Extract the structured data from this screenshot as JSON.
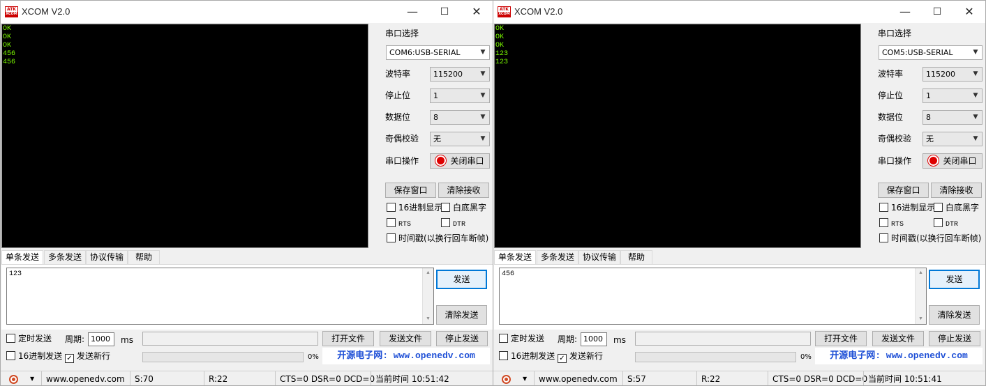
{
  "windows": [
    {
      "title": "XCOM V2.0",
      "logo_top": "ATK",
      "logo_bottom": "XCOM",
      "controls": {
        "minimize": "—",
        "maximize": "☐",
        "close": "✕"
      },
      "receive_lines": [
        "OK",
        "OK",
        "OK",
        "456",
        "456"
      ],
      "serial_port_label": "串口选择",
      "serial_port_value": "COM6:USB-SERIAL",
      "baud_label": "波特率",
      "baud_value": "115200",
      "stopbits_label": "停止位",
      "stopbits_value": "1",
      "databits_label": "数据位",
      "databits_value": "8",
      "parity_label": "奇偶校验",
      "parity_value": "无",
      "port_op_label": "串口操作",
      "close_port_label": "关闭串口",
      "save_window_label": "保存窗口",
      "clear_receive_label": "清除接收",
      "hex_display_label": "16进制显示",
      "white_bg_label": "白底黑字",
      "rts_label": "RTS",
      "dtr_label": "DTR",
      "timestamp_label": "时间戳(以换行回车断帧)",
      "tabs": [
        "单条发送",
        "多条发送",
        "协议传输",
        "帮助"
      ],
      "send_text": "123",
      "send_label": "发送",
      "clear_send_label": "清除发送",
      "timed_send_label": "定时发送",
      "period_label": "周期:",
      "period_value": "1000",
      "ms_label": "ms",
      "open_file_label": "打开文件",
      "send_file_label": "发送文件",
      "stop_send_label": "停止发送",
      "hex_send_label": "16进制发送",
      "newline_label": "发送新行",
      "newline_checked": "✓",
      "progress_percent": "0%",
      "link_text": "开源电子网: www.openedv.com",
      "status_url": "www.openedv.com",
      "status_sent": "S:70",
      "status_recv": "R:22",
      "status_lines": "CTS=0 DSR=0 DCD=0",
      "status_time": "当前时间 10:51:42"
    },
    {
      "title": "XCOM V2.0",
      "logo_top": "ATK",
      "logo_bottom": "XCOM",
      "controls": {
        "minimize": "—",
        "maximize": "☐",
        "close": "✕"
      },
      "receive_lines": [
        "OK",
        "OK",
        "OK",
        "123",
        "123"
      ],
      "serial_port_label": "串口选择",
      "serial_port_value": "COM5:USB-SERIAL",
      "baud_label": "波特率",
      "baud_value": "115200",
      "stopbits_label": "停止位",
      "stopbits_value": "1",
      "databits_label": "数据位",
      "databits_value": "8",
      "parity_label": "奇偶校验",
      "parity_value": "无",
      "port_op_label": "串口操作",
      "close_port_label": "关闭串口",
      "save_window_label": "保存窗口",
      "clear_receive_label": "清除接收",
      "hex_display_label": "16进制显示",
      "white_bg_label": "白底黑字",
      "rts_label": "RTS",
      "dtr_label": "DTR",
      "timestamp_label": "时间戳(以换行回车断帧)",
      "tabs": [
        "单条发送",
        "多条发送",
        "协议传输",
        "帮助"
      ],
      "send_text": "456",
      "send_label": "发送",
      "clear_send_label": "清除发送",
      "timed_send_label": "定时发送",
      "period_label": "周期:",
      "period_value": "1000",
      "ms_label": "ms",
      "open_file_label": "打开文件",
      "send_file_label": "发送文件",
      "stop_send_label": "停止发送",
      "hex_send_label": "16进制发送",
      "newline_label": "发送新行",
      "newline_checked": "✓",
      "progress_percent": "0%",
      "link_text": "开源电子网: www.openedv.com",
      "status_url": "www.openedv.com",
      "status_sent": "S:57",
      "status_recv": "R:22",
      "status_lines": "CTS=0 DSR=0 DCD=0",
      "status_time": "当前时间 10:51:41"
    }
  ]
}
